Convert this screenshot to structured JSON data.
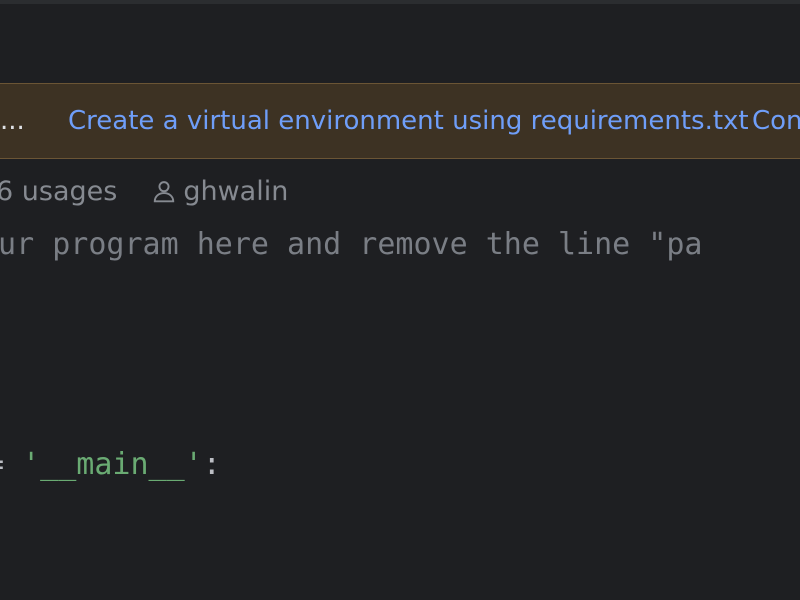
{
  "banner": {
    "ellipsis": "...",
    "link_venv": "Create a virtual environment using requirements.txt",
    "link_partial": "Con"
  },
  "inlay": {
    "usages": "6 usages",
    "author": "ghwalin"
  },
  "code": {
    "comment_line": "our program here and remove the line \"pa",
    "main_op": "= ",
    "main_string": "'__main__'",
    "main_colon": ":"
  },
  "icons": {
    "author": "person-icon"
  },
  "colors": {
    "editor_background": "#1e1f22",
    "banner_background": "#3d3223",
    "banner_link": "#6f9ef8",
    "string": "#6aab73",
    "comment": "#7a7e85"
  }
}
